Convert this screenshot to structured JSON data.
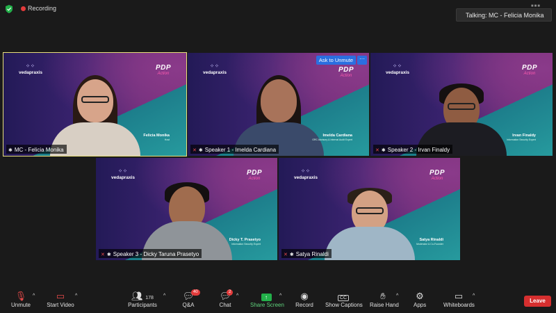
{
  "top": {
    "recording": "Recording",
    "talking": "Talking: MC - Felicia Monika"
  },
  "brand": {
    "logo": "vedapraxis",
    "pdp_line1": "PDP",
    "pdp_line2": "Action"
  },
  "tiles": [
    {
      "label": "MC - Felicia Monika",
      "plate_name": "Felicia Monika",
      "plate_title": "Host",
      "active": true
    },
    {
      "label": "Speaker 1 - Imelda Cardiana",
      "plate_name": "Imelda Cardiana",
      "plate_title": "GRC Advisory & Internal Audit Expert"
    },
    {
      "label": "Speaker 2 - Irvan Finaldy",
      "plate_name": "Irvan Finaldy",
      "plate_title": "Information Security Expert"
    },
    {
      "label": "Speaker 3 - Dicky Taruna Prasetyo",
      "plate_name": "Dicky T. Prasetyo",
      "plate_title": "Information Security Expert"
    },
    {
      "label": "Satya Rinaldi",
      "plate_name": "Satya Rinaldi",
      "plate_title": "Moderator & Co-Founder"
    }
  ],
  "ask_to_unmute": "Ask to Unmute",
  "more": "···",
  "toolbar": {
    "unmute": "Unmute",
    "start_video": "Start Video",
    "participants": "Participants",
    "participants_count": "178",
    "qa": "Q&A",
    "qa_badge": "40",
    "chat": "Chat",
    "chat_badge": "2",
    "share_screen": "Share Screen",
    "record": "Record",
    "show_captions": "Show Captions",
    "raise_hand": "Raise Hand",
    "apps": "Apps",
    "whiteboards": "Whiteboards",
    "leave": "Leave",
    "captions_icon": "CC"
  },
  "colors": {
    "accent_share": "#23b04a",
    "leave": "#d62f2f",
    "ask_button": "#2b6fe0",
    "active_border": "#e8e07a"
  }
}
